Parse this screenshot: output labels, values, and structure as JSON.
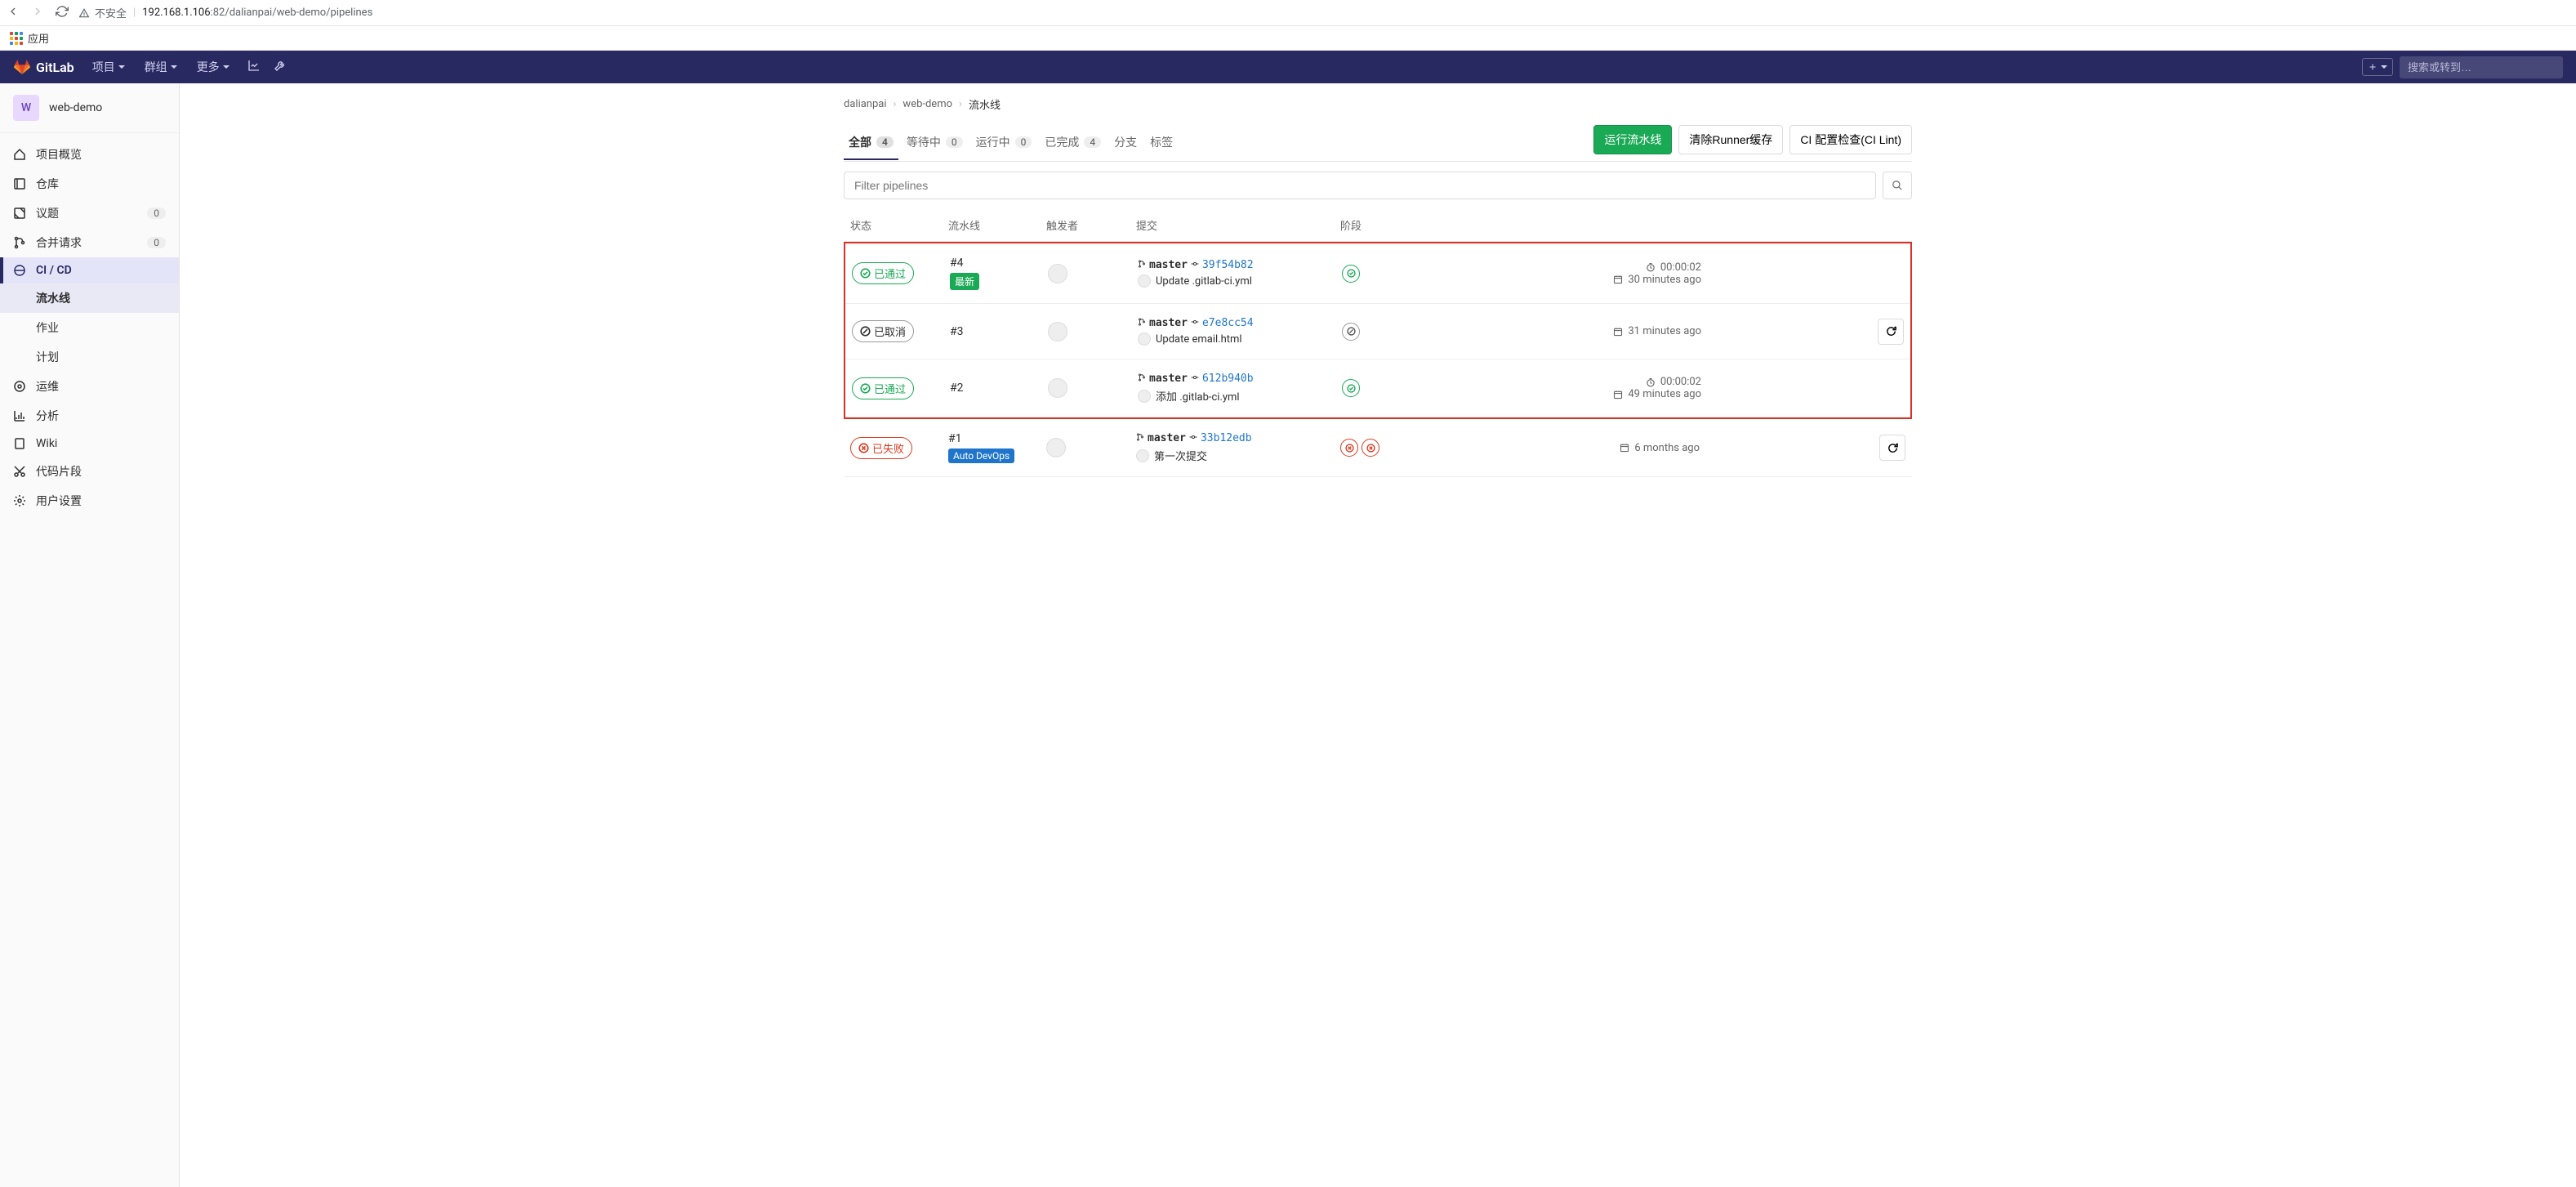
{
  "browser": {
    "insecure_label": "不安全",
    "url_host": "192.168.1.106",
    "url_port": ":82",
    "url_path": "/dalianpai/web-demo/pipelines",
    "apps_label": "应用"
  },
  "header": {
    "brand": "GitLab",
    "nav": {
      "projects": "项目",
      "groups": "群组",
      "more": "更多"
    },
    "search_placeholder": "搜索或转到…"
  },
  "sidebar": {
    "project_initial": "W",
    "project_name": "web-demo",
    "items": {
      "overview": "项目概览",
      "repo": "仓库",
      "issues": "议题",
      "issues_count": "0",
      "merge": "合并请求",
      "merge_count": "0",
      "cicd": "CI / CD",
      "ops": "运维",
      "analytics": "分析",
      "wiki": "Wiki",
      "snippets": "代码片段",
      "settings": "用户设置"
    },
    "sub": {
      "pipelines": "流水线",
      "jobs": "作业",
      "schedules": "计划"
    }
  },
  "breadcrumb": {
    "a": "dalianpai",
    "b": "web-demo",
    "c": "流水线"
  },
  "tabs": {
    "all": "全部",
    "all_count": "4",
    "pending": "等待中",
    "pending_count": "0",
    "running": "运行中",
    "running_count": "0",
    "finished": "已完成",
    "finished_count": "4",
    "branches": "分支",
    "tags": "标签"
  },
  "actions": {
    "run": "运行流水线",
    "clear": "清除Runner缓存",
    "lint": "CI 配置检查(CI Lint)"
  },
  "filter_placeholder": "Filter pipelines",
  "columns": {
    "status": "状态",
    "pipeline": "流水线",
    "trigger": "触发者",
    "commit": "提交",
    "stages": "阶段"
  },
  "status_labels": {
    "passed": "已通过",
    "canceled": "已取消",
    "failed": "已失败"
  },
  "labels": {
    "latest": "最新",
    "autodevops": "Auto DevOps"
  },
  "branch_name": "master",
  "pipelines": [
    {
      "id": "#4",
      "status": "passed",
      "label": "latest",
      "sha": "39f54b82",
      "msg": "Update .gitlab-ci.yml",
      "stages": [
        "passed"
      ],
      "duration": "00:00:02",
      "ago": "30 minutes ago",
      "retry": false
    },
    {
      "id": "#3",
      "status": "canceled",
      "label": "",
      "sha": "e7e8cc54",
      "msg": "Update email.html",
      "stages": [
        "canceled"
      ],
      "duration": "",
      "ago": "31 minutes ago",
      "retry": true
    },
    {
      "id": "#2",
      "status": "passed",
      "label": "",
      "sha": "612b940b",
      "msg": "添加 .gitlab-ci.yml",
      "stages": [
        "passed"
      ],
      "duration": "00:00:02",
      "ago": "49 minutes ago",
      "retry": false
    },
    {
      "id": "#1",
      "status": "failed",
      "label": "autodevops",
      "sha": "33b12edb",
      "msg": "第一次提交",
      "stages": [
        "failed",
        "failed"
      ],
      "duration": "",
      "ago": "6 months ago",
      "retry": true
    }
  ]
}
